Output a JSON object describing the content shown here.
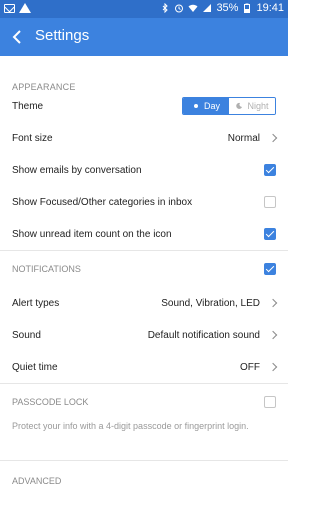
{
  "status_bar": {
    "battery_percent": "35%",
    "time": "19:41"
  },
  "app_bar": {
    "title": "Settings"
  },
  "appearance": {
    "header": "APPEARANCE",
    "theme": {
      "label": "Theme",
      "options": [
        "Day",
        "Night"
      ],
      "selected": "Day"
    },
    "font_size": {
      "label": "Font size",
      "value": "Normal"
    },
    "show_emails_by_conversation": {
      "label": "Show emails by conversation",
      "checked": true
    },
    "focused_other": {
      "label": "Show Focused/Other categories in inbox",
      "checked": false
    },
    "unread_count": {
      "label": "Show unread item count on the icon",
      "checked": true
    }
  },
  "notifications": {
    "header": "NOTIFICATIONS",
    "checked": true,
    "alert_types": {
      "label": "Alert types",
      "value": "Sound, Vibration, LED"
    },
    "sound": {
      "label": "Sound",
      "value": "Default notification sound"
    },
    "quiet_time": {
      "label": "Quiet time",
      "value": "OFF"
    }
  },
  "passcode": {
    "header": "PASSCODE LOCK",
    "checked": false,
    "description": "Protect your info with a 4-digit passcode or fingerprint login."
  },
  "advanced": {
    "header": "ADVANCED"
  },
  "colors": {
    "status_bar": "#2f6fc9",
    "app_bar": "#3c82df",
    "accent": "#3c82df"
  }
}
